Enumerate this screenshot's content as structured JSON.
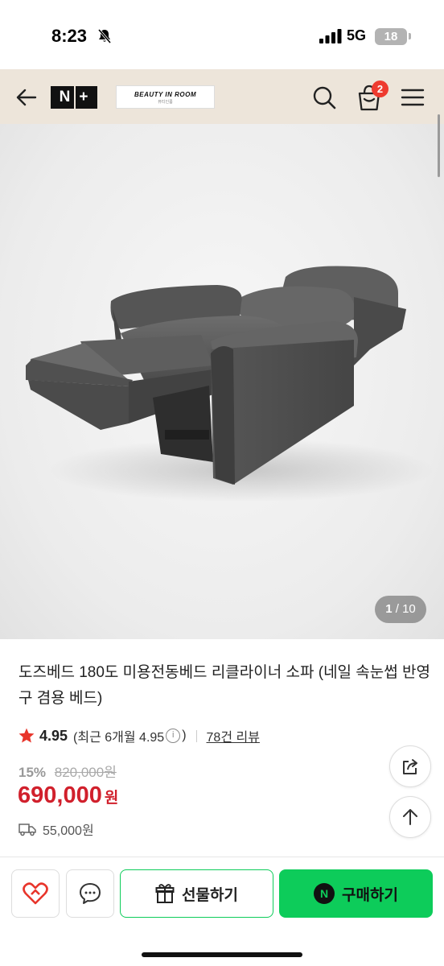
{
  "status_bar": {
    "time": "8:23",
    "network": "5G",
    "battery": "18",
    "icons": [
      "bell-slash-icon",
      "signal-icon",
      "battery-icon"
    ]
  },
  "header": {
    "logo_n": "N",
    "logo_plus": "+",
    "brand_name": "BEAUTY IN ROOM",
    "brand_sub": "뷰티인룸",
    "cart_count": "2",
    "icons": [
      "back-arrow-icon",
      "search-icon",
      "shopping-bag-icon",
      "hamburger-menu-icon"
    ]
  },
  "gallery": {
    "current": "1",
    "separator": "/",
    "total": "10",
    "image_subject": "grey leather power recliner sofa, reclined"
  },
  "product": {
    "title": "도즈베드 180도 미용전동베드 리클라이너 소파 (네일 속눈썹 반영구 겸용 베드)",
    "rating": "4.95",
    "recent_rating_label": "(최근 6개월 4.95",
    "info_glyph": "i",
    "recent_rating_close": ")",
    "review_link": "78건 리뷰",
    "discount_rate": "15%",
    "original_price": "820,000원",
    "price": "690,000",
    "price_unit": "원",
    "shipping_fee": "55,000원"
  },
  "actions": {
    "gift_label": "선물하기",
    "buy_label": "구매하기",
    "npay_glyph": "N"
  },
  "colors": {
    "header_bg": "#ede5da",
    "price_red": "#d1202c",
    "naver_green": "#0dcc5a",
    "badge_red": "#ee3b2f",
    "star_red": "#e8352b"
  }
}
